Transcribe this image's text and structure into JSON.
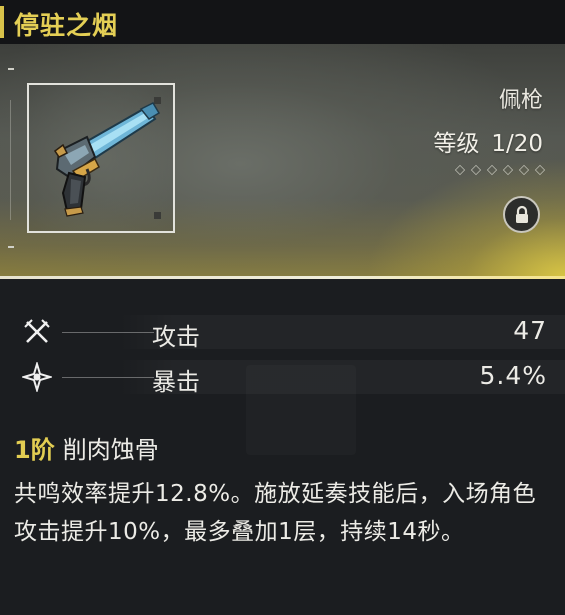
{
  "title": "停驻之烟",
  "item": {
    "type": "佩枪",
    "level_label": "等级",
    "level_value": "1/20",
    "rank_dots": 6,
    "locked": true,
    "icon": "pistol-icon"
  },
  "stats": [
    {
      "icon": "crossed-swords-icon",
      "label": "攻击",
      "value": "47"
    },
    {
      "icon": "crit-star-icon",
      "label": "暴击",
      "value": "5.4%"
    }
  ],
  "passive": {
    "rank": "1阶",
    "name": "削肉蚀骨",
    "description": "共鸣效率提升12.8%。施放延奏技能后，入场角色攻击提升10%，最多叠加1层，持续14秒。"
  },
  "colors": {
    "title": "#e4cf55",
    "accent": "#d8c24a",
    "text": "#ecebe6"
  }
}
